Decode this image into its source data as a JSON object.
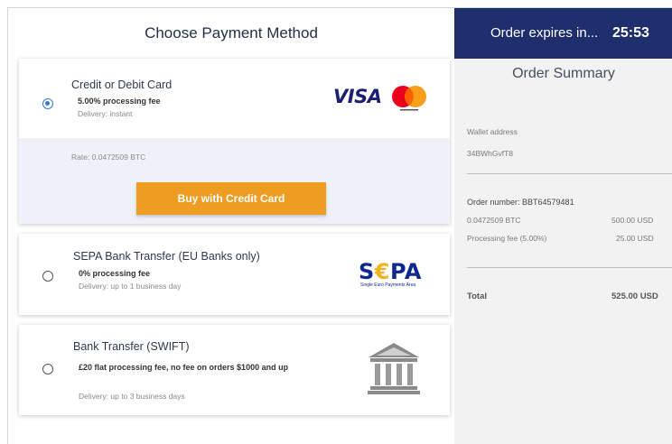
{
  "left": {
    "title": "Choose Payment Method",
    "methods": [
      {
        "title": "Credit or Debit Card",
        "fee": "5.00% processing fee",
        "delivery": "Delivery: instant",
        "rate": "Rate: 0.0472509 BTC",
        "button": "Buy with Credit Card",
        "logo": "visa-mastercard-logo",
        "selected": true
      },
      {
        "title": "SEPA Bank Transfer (EU Banks only)",
        "fee": "0% processing fee",
        "delivery": "Delivery: up to 1 business day",
        "logo_text_a": "S",
        "logo_text_euro": "€",
        "logo_text_b": "PA",
        "logo_sub": "Single Euro Payments Area",
        "selected": false
      },
      {
        "title": "Bank Transfer (SWIFT)",
        "fee": "£20 flat processing fee, no fee on orders $1000 and up",
        "delivery": "Delivery: up to 3 business days",
        "logo": "bank-icon",
        "selected": false
      }
    ]
  },
  "right": {
    "expires_label": "Order expires in...",
    "expires_time": "25:53",
    "summary_title": "Order Summary",
    "wallet_label": "Wallet address",
    "wallet_value": "34BWhGvfT8",
    "order_number": "Order number: BBT64579481",
    "line_item_label": "0.0472509 BTC",
    "line_item_value": "500.00 USD",
    "fee_label": "Processing fee (5.00%)",
    "fee_value": "25.00 USD",
    "total_label": "Total",
    "total_value": "525.00 USD"
  },
  "colors": {
    "accent_orange": "#ef9c22",
    "header_navy": "#1f2e6d",
    "radio_blue": "#3a79d6",
    "selected_bg": "#eef1f7"
  }
}
